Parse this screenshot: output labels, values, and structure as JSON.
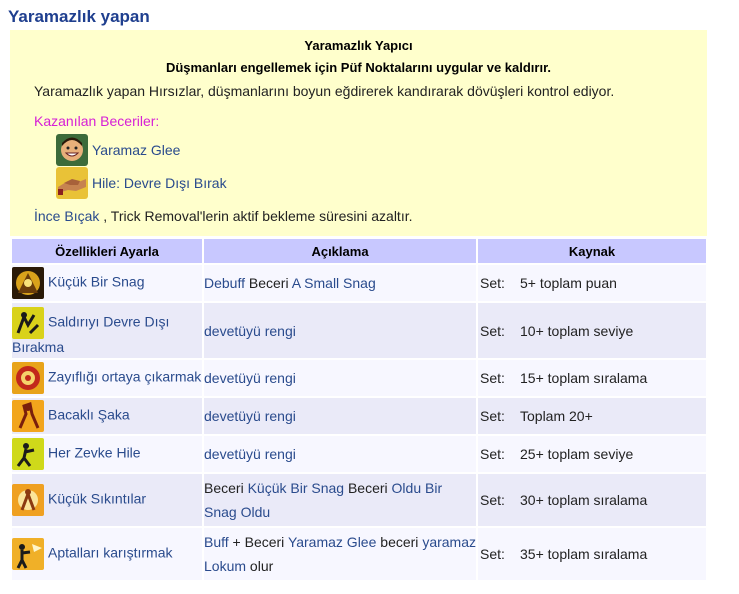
{
  "title": "Yaramazlık yapan",
  "infobox": {
    "name": "Yaramazlık Yapıcı",
    "description": "Düşmanları engellemek için Püf Noktalarını uygular ve kaldırır.",
    "flavor": "Yaramazlık yapan Hırsızlar, düşmanlarını boyun eğdirerek kandırarak dövüşleri kontrol ediyor.",
    "skills_label": "Kazanılan Beceriler:",
    "skills": [
      {
        "label": "Yaramaz Glee",
        "icon": "grinning-face-icon"
      },
      {
        "label": "Hile: Devre Dışı Bırak",
        "icon": "handshake-icon"
      }
    ],
    "note_link": "İnce Bıçak",
    "note_text": " , Trick Removal'lerin aktif bekleme süresini azaltır."
  },
  "table": {
    "headers": [
      "Özellikleri Ayarla",
      "Açıklama",
      "Kaynak"
    ],
    "rows": [
      {
        "icon": "snag-icon",
        "name": "Küçük Bir Snag",
        "desc": [
          {
            "t": "Debuff",
            "l": true
          },
          {
            "t": " Beceri ",
            "l": false
          },
          {
            "t": "A Small Snag",
            "l": true
          }
        ],
        "set": "Set:",
        "source": "5+ toplam puan"
      },
      {
        "icon": "disarm-icon",
        "name": "Saldırıyı Devre Dışı Bırakma",
        "desc": [
          {
            "t": "devetüyü rengi",
            "l": true
          }
        ],
        "set": "Set:",
        "source": "10+ toplam seviye"
      },
      {
        "icon": "weakness-icon",
        "name": "Zayıflığı ortaya çıkarmak",
        "desc": [
          {
            "t": "devetüyü rengi",
            "l": true
          }
        ],
        "set": "Set:",
        "source": "15+ toplam sıralama"
      },
      {
        "icon": "prank-icon",
        "name": "Bacaklı Şaka",
        "desc": [
          {
            "t": "devetüyü rengi",
            "l": true
          }
        ],
        "set": "Set:",
        "source": "Toplam 20+"
      },
      {
        "icon": "trick-icon",
        "name": "Her Zevke Hile",
        "desc": [
          {
            "t": "devetüyü rengi",
            "l": true
          }
        ],
        "set": "Set:",
        "source": "25+ toplam seviye"
      },
      {
        "icon": "trouble-icon",
        "name": "Küçük Sıkıntılar",
        "desc": [
          {
            "t": "Beceri ",
            "l": false
          },
          {
            "t": "Küçük Bir Snag",
            "l": true
          },
          {
            "t": " Beceri ",
            "l": false
          },
          {
            "t": "Oldu Bir Snag Oldu",
            "l": true
          }
        ],
        "set": "Set:",
        "source": "30+ toplam sıralama"
      },
      {
        "icon": "confuse-icon",
        "name": "Aptalları karıştırmak",
        "desc": [
          {
            "t": "Buff",
            "l": true
          },
          {
            "t": " + Beceri ",
            "l": false
          },
          {
            "t": "Yaramaz Glee",
            "l": true
          },
          {
            "t": " beceri ",
            "l": false
          },
          {
            "t": "yaramaz Lokum",
            "l": true
          },
          {
            "t": " olur",
            "l": false
          }
        ],
        "set": "Set:",
        "source": "35+ toplam sıralama"
      }
    ]
  }
}
